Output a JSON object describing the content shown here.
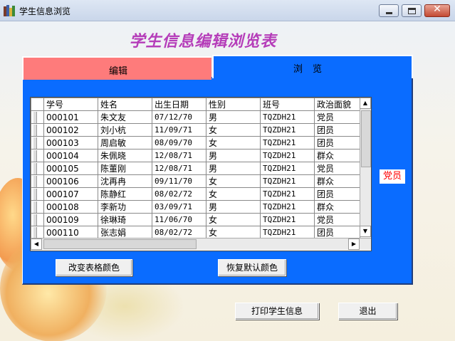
{
  "window": {
    "title": "学生信息浏览"
  },
  "heading": "学生信息编辑浏览表",
  "tabs": [
    {
      "label": "编辑",
      "color": "#fe7b7b"
    },
    {
      "label": "浏览",
      "color": "#0a6cff"
    }
  ],
  "grid": {
    "columns": [
      "学号",
      "姓名",
      "出生日期",
      "性别",
      "班号",
      "政治面貌"
    ],
    "rows": [
      [
        "000101",
        "朱文友",
        "07/12/70",
        "男",
        "TQZDH21",
        "党员"
      ],
      [
        "000102",
        "刘小杭",
        "11/09/71",
        "女",
        "TQZDH21",
        "团员"
      ],
      [
        "000103",
        "周启敏",
        "08/09/70",
        "女",
        "TQZDH21",
        "团员"
      ],
      [
        "000104",
        "朱佩晓",
        "12/08/71",
        "男",
        "TQZDH21",
        "群众"
      ],
      [
        "000105",
        "陈董刚",
        "12/08/71",
        "男",
        "TQZDH21",
        "党员"
      ],
      [
        "000106",
        "沈再冉",
        "09/11/70",
        "女",
        "TQZDH21",
        "群众"
      ],
      [
        "000107",
        "陈静红",
        "08/02/72",
        "女",
        "TQZDH21",
        "团员"
      ],
      [
        "000108",
        "李新功",
        "03/09/71",
        "男",
        "TQZDH21",
        "群众"
      ],
      [
        "000109",
        "徐琳琦",
        "11/06/70",
        "女",
        "TQZDH21",
        "党员"
      ],
      [
        "000110",
        "张志娟",
        "08/02/72",
        "女",
        "TQZDH21",
        "团员"
      ]
    ]
  },
  "status_value": "党员",
  "buttons": {
    "change_color": "改变表格颜色",
    "restore_color": "恢复默认颜色",
    "print": "打印学生信息",
    "exit": "退出"
  },
  "window_controls": {
    "close_glyph": "✕"
  },
  "colors": {
    "panel": "#0a6cff",
    "title": "#b53db9",
    "highlight": "#ff0000"
  }
}
